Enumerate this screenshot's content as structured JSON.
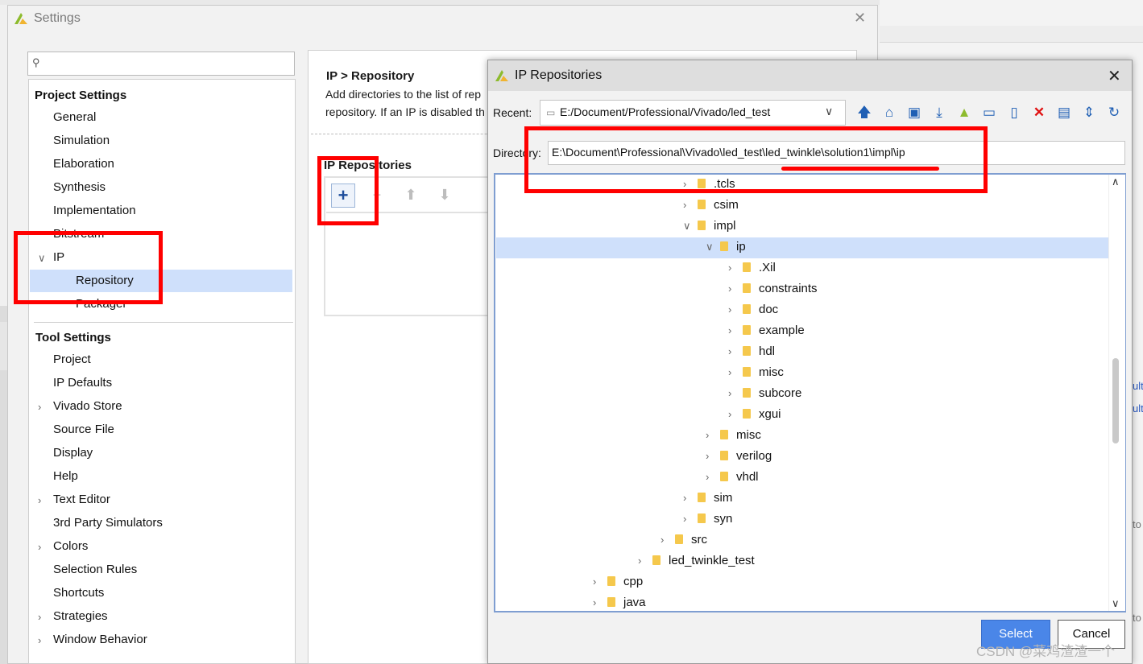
{
  "settings": {
    "title": "Settings",
    "search_placeholder": "",
    "project_settings_heading": "Project Settings",
    "project_items": [
      "General",
      "Simulation",
      "Elaboration",
      "Synthesis",
      "Implementation",
      "Bitstream",
      "IP"
    ],
    "ip_children": [
      "Repository",
      "Packager"
    ],
    "tool_settings_heading": "Tool Settings",
    "tool_items": [
      "Project",
      "IP Defaults",
      "Vivado Store",
      "Source File",
      "Display",
      "Help",
      "Text Editor",
      "3rd Party Simulators",
      "Colors",
      "Selection Rules",
      "Shortcuts",
      "Strategies",
      "Window Behavior"
    ],
    "breadcrumb": "IP > Repository",
    "description_line1": "Add directories to the list of rep",
    "description_line2": "repository. If an IP is disabled th",
    "repo_section_title": "IP Repositories",
    "toolbar_icons": [
      "add-icon",
      "remove-icon",
      "move-up-icon",
      "move-down-icon"
    ]
  },
  "dialog": {
    "title": "IP Repositories",
    "recent_label": "Recent:",
    "recent_value": "E:/Document/Professional/Vivado/led_test",
    "directory_label": "Directory:",
    "directory_value": "E:\\Document\\Professional\\Vivado\\led_test\\led_twinkle\\solution1\\impl\\ip",
    "toolbar_icons": [
      "up-folder-icon",
      "home-icon",
      "desktop-icon",
      "download-icon",
      "vivado-icon",
      "computer-icon",
      "new-file-icon",
      "delete-icon",
      "new-folder-icon",
      "collapse-icon",
      "refresh-icon"
    ],
    "tree": [
      {
        "label": ".tcls",
        "level": 3,
        "state": "collapsed"
      },
      {
        "label": "csim",
        "level": 3,
        "state": "collapsed"
      },
      {
        "label": "impl",
        "level": 3,
        "state": "expanded"
      },
      {
        "label": "ip",
        "level": 4,
        "state": "expanded",
        "selected": true
      },
      {
        "label": ".Xil",
        "level": 5,
        "state": "collapsed"
      },
      {
        "label": "constraints",
        "level": 5,
        "state": "collapsed"
      },
      {
        "label": "doc",
        "level": 5,
        "state": "collapsed"
      },
      {
        "label": "example",
        "level": 5,
        "state": "collapsed"
      },
      {
        "label": "hdl",
        "level": 5,
        "state": "collapsed"
      },
      {
        "label": "misc",
        "level": 5,
        "state": "collapsed"
      },
      {
        "label": "subcore",
        "level": 5,
        "state": "collapsed"
      },
      {
        "label": "xgui",
        "level": 5,
        "state": "collapsed"
      },
      {
        "label": "misc",
        "level": 4,
        "state": "collapsed"
      },
      {
        "label": "verilog",
        "level": 4,
        "state": "collapsed"
      },
      {
        "label": "vhdl",
        "level": 4,
        "state": "collapsed"
      },
      {
        "label": "sim",
        "level": 3,
        "state": "collapsed"
      },
      {
        "label": "syn",
        "level": 3,
        "state": "collapsed"
      },
      {
        "label": "src",
        "level": 2,
        "state": "collapsed"
      },
      {
        "label": "led_twinkle_test",
        "level": 1,
        "state": "collapsed"
      },
      {
        "label": "cpp",
        "level": 0,
        "state": "collapsed"
      },
      {
        "label": "java",
        "level": 0,
        "state": "collapsed"
      }
    ],
    "select_button": "Select",
    "cancel_button": "Cancel"
  },
  "background_edge_texts": [
    "ults",
    "ult",
    "to",
    "to"
  ],
  "watermark": "CSDN @菜鸡渣渣一个",
  "colors": {
    "selection": "#cfe0fb",
    "annotation_red": "#ff0000",
    "primary_button": "#4a86e8"
  }
}
